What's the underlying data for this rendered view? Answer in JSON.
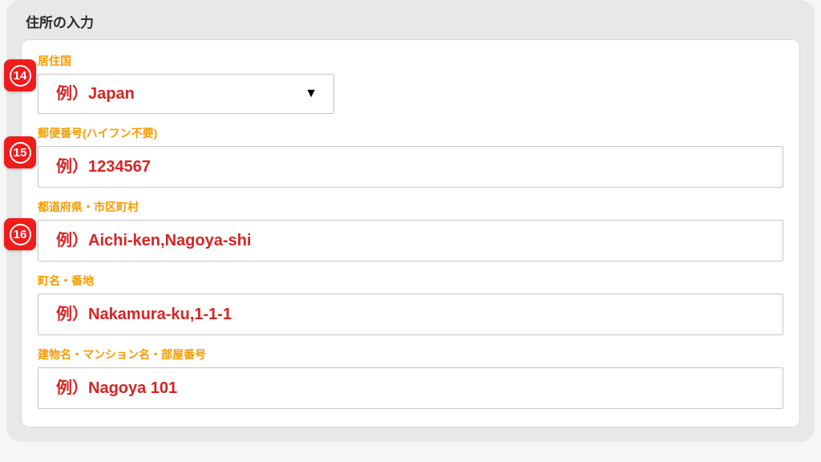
{
  "section_title": "住所の入力",
  "markers": {
    "m14": "14",
    "m15": "15",
    "m16": "16"
  },
  "fields": {
    "country": {
      "label": "居住国",
      "placeholder": "例）Japan"
    },
    "postal": {
      "label": "郵便番号(ハイフン不要)",
      "placeholder": "例）1234567"
    },
    "prefecture_city": {
      "label": "都道府県・市区町村",
      "placeholder": "例）Aichi-ken,Nagoya-shi"
    },
    "street": {
      "label": "町名・番地",
      "placeholder": "例）Nakamura-ku,1-1-1"
    },
    "building": {
      "label": "建物名・マンション名・部屋番号",
      "placeholder": "例）Nagoya 101"
    }
  }
}
